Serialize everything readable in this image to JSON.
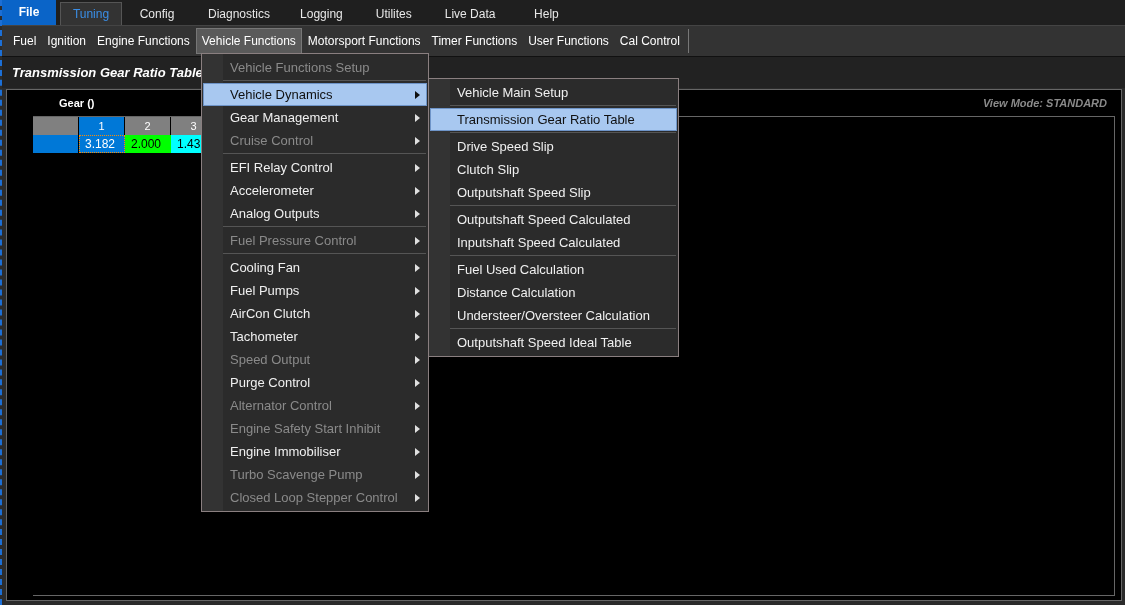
{
  "menu_bar": [
    {
      "label": "File",
      "kind": "file",
      "selected": false
    },
    {
      "label": "Tuning",
      "kind": "tab",
      "selected": true
    },
    {
      "label": "Config",
      "kind": "tab",
      "selected": false
    },
    {
      "label": "Diagnostics",
      "kind": "tab",
      "selected": false
    },
    {
      "label": "Logging",
      "kind": "tab",
      "selected": false
    },
    {
      "label": "Utilites",
      "kind": "tab",
      "selected": false
    },
    {
      "label": "Live Data",
      "kind": "tab",
      "selected": false
    },
    {
      "label": "Help",
      "kind": "tab",
      "selected": false
    }
  ],
  "toolbar": [
    {
      "label": "Fuel",
      "selected": false
    },
    {
      "label": "Ignition",
      "selected": false
    },
    {
      "label": "Engine Functions",
      "selected": false
    },
    {
      "label": "Vehicle Functions",
      "selected": true
    },
    {
      "label": "Motorsport Functions",
      "selected": false
    },
    {
      "label": "Timer Functions",
      "selected": false
    },
    {
      "label": "User Functions",
      "selected": false
    },
    {
      "label": "Cal Control",
      "selected": false
    }
  ],
  "panel": {
    "title": "Transmission Gear Ratio Table",
    "axis_label": "Gear ()",
    "view_mode": "View Mode: STANDARD",
    "table": {
      "columns": [
        {
          "label": "1",
          "selected": true
        },
        {
          "label": "2",
          "selected": false
        },
        {
          "label": "3",
          "selected": false
        }
      ],
      "cells": [
        {
          "value": "3.182",
          "color": "#0078d7",
          "selected": true
        },
        {
          "value": "2.000",
          "color": "#00ff00",
          "selected": false
        },
        {
          "value": "1.43",
          "color": "#00ffff",
          "selected": false
        }
      ]
    }
  },
  "dropdown": {
    "groups": [
      [
        {
          "label": "Vehicle Functions Setup",
          "disabled": true,
          "submenu": false,
          "selected": false
        }
      ],
      [
        {
          "label": "Vehicle Dynamics",
          "disabled": false,
          "submenu": true,
          "selected": true
        },
        {
          "label": "Gear Management",
          "disabled": false,
          "submenu": true,
          "selected": false
        },
        {
          "label": "Cruise Control",
          "disabled": true,
          "submenu": true,
          "selected": false
        }
      ],
      [
        {
          "label": "EFI Relay Control",
          "disabled": false,
          "submenu": true,
          "selected": false
        },
        {
          "label": "Accelerometer",
          "disabled": false,
          "submenu": true,
          "selected": false
        },
        {
          "label": "Analog Outputs",
          "disabled": false,
          "submenu": true,
          "selected": false
        }
      ],
      [
        {
          "label": "Fuel Pressure Control",
          "disabled": true,
          "submenu": true,
          "selected": false
        }
      ],
      [
        {
          "label": "Cooling Fan",
          "disabled": false,
          "submenu": true,
          "selected": false
        },
        {
          "label": "Fuel Pumps",
          "disabled": false,
          "submenu": true,
          "selected": false
        },
        {
          "label": "AirCon Clutch",
          "disabled": false,
          "submenu": true,
          "selected": false
        },
        {
          "label": "Tachometer",
          "disabled": false,
          "submenu": true,
          "selected": false
        },
        {
          "label": "Speed Output",
          "disabled": true,
          "submenu": true,
          "selected": false
        },
        {
          "label": "Purge Control",
          "disabled": false,
          "submenu": true,
          "selected": false
        },
        {
          "label": "Alternator Control",
          "disabled": true,
          "submenu": true,
          "selected": false
        },
        {
          "label": "Engine Safety Start Inhibit",
          "disabled": true,
          "submenu": true,
          "selected": false
        },
        {
          "label": "Engine Immobiliser",
          "disabled": false,
          "submenu": true,
          "selected": false
        },
        {
          "label": "Turbo Scavenge Pump",
          "disabled": true,
          "submenu": true,
          "selected": false
        },
        {
          "label": "Closed Loop Stepper Control",
          "disabled": true,
          "submenu": true,
          "selected": false
        }
      ]
    ]
  },
  "submenu": {
    "groups": [
      [
        {
          "label": "Vehicle Main Setup",
          "disabled": false,
          "submenu": false,
          "selected": false
        }
      ],
      [
        {
          "label": "Transmission Gear Ratio Table",
          "disabled": false,
          "submenu": false,
          "selected": true
        }
      ],
      [
        {
          "label": "Drive Speed Slip",
          "disabled": false,
          "submenu": false,
          "selected": false
        },
        {
          "label": "Clutch Slip",
          "disabled": false,
          "submenu": false,
          "selected": false
        },
        {
          "label": "Outputshaft Speed Slip",
          "disabled": false,
          "submenu": false,
          "selected": false
        }
      ],
      [
        {
          "label": "Outputshaft Speed Calculated",
          "disabled": false,
          "submenu": false,
          "selected": false
        },
        {
          "label": "Inputshaft Speed Calculated",
          "disabled": false,
          "submenu": false,
          "selected": false
        }
      ],
      [
        {
          "label": "Fuel Used Calculation",
          "disabled": false,
          "submenu": false,
          "selected": false
        },
        {
          "label": "Distance Calculation",
          "disabled": false,
          "submenu": false,
          "selected": false
        },
        {
          "label": "Understeer/Oversteer Calculation",
          "disabled": false,
          "submenu": false,
          "selected": false
        }
      ],
      [
        {
          "label": "Outputshaft Speed Ideal Table",
          "disabled": false,
          "submenu": false,
          "selected": false
        }
      ]
    ]
  }
}
